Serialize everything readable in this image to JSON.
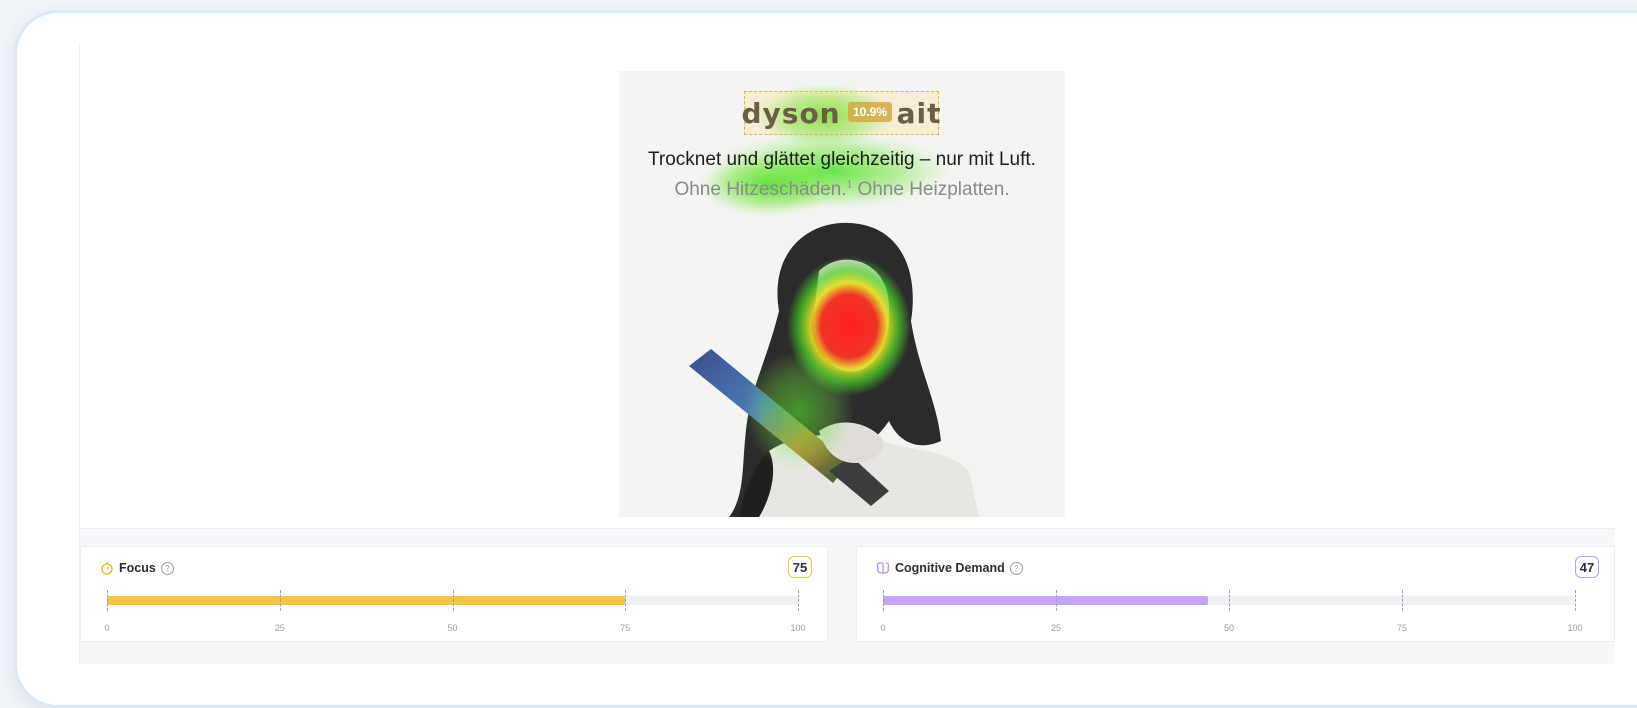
{
  "ad": {
    "brand": "dyson",
    "brand_suffix": "ait",
    "attention_badge": "10.9%",
    "headline": "Trocknet und glättet gleichzeitig – nur mit Luft.",
    "subline_a": "Ohne Hitzeschäden.",
    "subline_sup": "1",
    "subline_b": " Ohne Heizplatten."
  },
  "metrics": {
    "focus": {
      "label": "Focus",
      "score": "75",
      "value": 75,
      "color": "#f6c445",
      "ticks": [
        "0",
        "25",
        "50",
        "75",
        "100"
      ]
    },
    "cognitive": {
      "label": "Cognitive Demand",
      "score": "47",
      "value": 47,
      "color": "#c4a4f4",
      "ticks": [
        "0",
        "25",
        "50",
        "75",
        "100"
      ]
    }
  },
  "icons": {
    "focus": "timer-icon",
    "cognitive": "brain-icon",
    "help": "help-circle-icon"
  }
}
